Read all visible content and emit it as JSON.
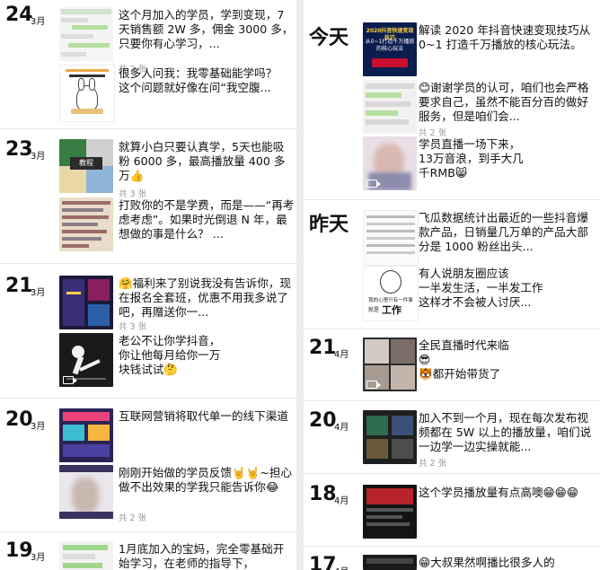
{
  "left": {
    "days": [
      {
        "day": "24",
        "month": "3月",
        "posts": [
          {
            "text": "这个月加入的学员，学到变现，7天销售额 2W 多，佣金 3000 多，只要你有心学习，...",
            "count": "共 2 张",
            "thumb": "chat-screenshot"
          },
          {
            "text": "很多人问我：我零基础能学吗？\n这个问题就好像在问“我空腹...",
            "count": "",
            "thumb": "cartoon-rabbit"
          }
        ]
      },
      {
        "day": "23",
        "month": "3月",
        "posts": [
          {
            "text": "就算小白只要认真学，5天也能吸粉 6000 多，最高播放量 400 多万👍",
            "count": "共 3 张",
            "thumb": "collage"
          },
          {
            "text": "打败你的不是学费，而是——“再考虑考虑”。如果时光倒退 N 年，最想做的事是什么？ ...",
            "count": "",
            "thumb": "notes"
          }
        ]
      },
      {
        "day": "21",
        "month": "3月",
        "posts": [
          {
            "text": "🤗福利来了别说我没有告诉你，现在报名全套班，优惠不用我多说了吧，再赠送你一...",
            "count": "共 3 张",
            "thumb": "dark-collage"
          },
          {
            "text": "老公不让你学抖音，\n你让他每月给你一万\n块钱试试🤔",
            "count": "",
            "thumb": "silhouette"
          }
        ]
      },
      {
        "day": "20",
        "month": "3月",
        "posts": [
          {
            "text": "互联网营销将取代单一的线下渠道",
            "count": "",
            "thumb": "phone-colorful"
          },
          {
            "text": "刚刚开始做的学员反馈🤘🤘~担心做不出效果的学我只能告诉你😂",
            "count": "共 2 张",
            "thumb": "blur-person"
          }
        ]
      },
      {
        "day": "19",
        "month": "3月",
        "posts": [
          {
            "text": "1月底加入的宝妈，完全零基础开始学习，在老师的指导下，",
            "count": "",
            "thumb": "green-screenshot"
          }
        ]
      }
    ]
  },
  "right": {
    "days": [
      {
        "label": "今天",
        "posts": [
          {
            "text": "解读 2020 年抖音快速变现技巧从 0~1 打造千万播放的核心玩法。",
            "count": "",
            "thumb": "blue-banner",
            "banner": "2020抖音快速变现技巧",
            "banner2": "从0~1打造千万播放的核心玩法"
          },
          {
            "text": "😊谢谢学员的认可，咱们也会严格要求自己，虽然不能百分百的做好服务，但是咱们会...",
            "count": "共 2 张",
            "thumb": "chat-list"
          },
          {
            "text": "学员直播一场下来，\n13万音浪，到手大几\n千RMB😸",
            "count": "",
            "thumb": "face-blur"
          }
        ]
      },
      {
        "label": "昨天",
        "posts": [
          {
            "text": "飞瓜数据统计出最近的一些抖音爆款产品，日销量几万单的产品大部分是 1000 粉丝出头...",
            "count": "",
            "thumb": "data-table"
          },
          {
            "text": "有人说朋友圈应该\n一半发生活，一半发工作\n这样才不会被人讨厌...",
            "count": "",
            "thumb": "sketch",
            "sketch_text": "我的心里只有一件事",
            "sketch_text2": "就是",
            "sketch_word": "工作"
          }
        ]
      },
      {
        "day": "21",
        "month": "4月",
        "posts": [
          {
            "text": "全民直播时代来临\n😎\n🐯都开始带货了",
            "count": "",
            "thumb": "live-grid"
          }
        ]
      },
      {
        "day": "20",
        "month": "4月",
        "posts": [
          {
            "text": "加入不到一个月，现在每次发布视频都在 5W 以上的播放量，咱们说一边学一边实操就能...",
            "count": "共 2 张",
            "thumb": "dark-phone"
          }
        ]
      },
      {
        "day": "18",
        "month": "4月",
        "posts": [
          {
            "text": "这个学员播放量有点高噢😁😁😁",
            "count": "",
            "thumb": "red-phone"
          }
        ]
      },
      {
        "day": "17",
        "month": "4月",
        "posts": [
          {
            "text": "😁大叔果然啊播比很多人的",
            "count": "",
            "thumb": "dark-strip"
          }
        ]
      }
    ]
  },
  "colors": {
    "text": "#111111",
    "muted": "#999999",
    "panel": "#ffffff",
    "background": "#ececec"
  }
}
